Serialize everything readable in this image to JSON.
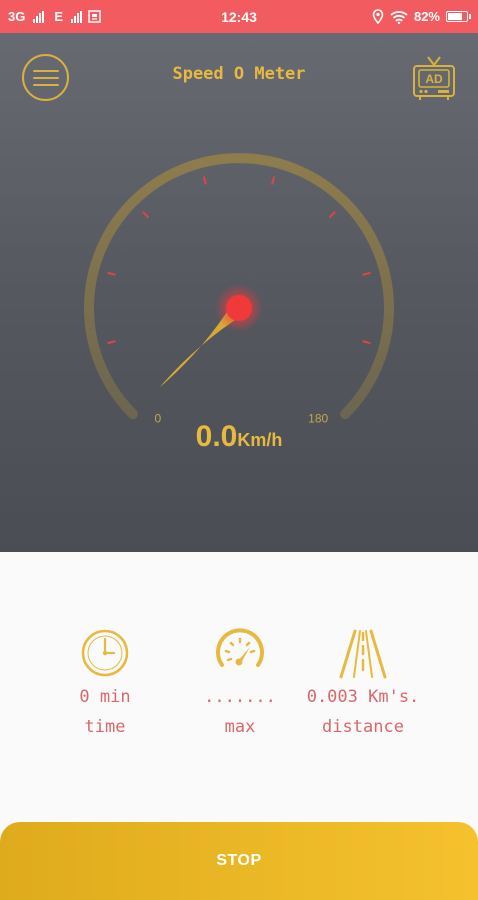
{
  "status_bar": {
    "network_1": "3G",
    "network_2": "E",
    "time": "12:43",
    "battery": "82%"
  },
  "header": {
    "title": "Speed O Meter",
    "ad_label": "AD"
  },
  "gauge": {
    "min_label": "0",
    "max_label": "180",
    "speed_value": "0.0",
    "speed_unit": "Km/h",
    "speed": 0,
    "min": 0,
    "max": 180
  },
  "stats": {
    "time": {
      "value": "0 min",
      "label": "time",
      "icon": "clock-icon"
    },
    "max": {
      "value": ".......",
      "label": "max",
      "icon": "speedometer-icon"
    },
    "distance": {
      "value": "0.003 Km's.",
      "label": "distance",
      "icon": "road-icon"
    }
  },
  "stop_button": {
    "label": "STOP"
  },
  "colors": {
    "accent": "#e8b93f",
    "status_bar": "#f25c60",
    "stat_text": "#d9686a",
    "needle_hub": "#f03a3a"
  }
}
